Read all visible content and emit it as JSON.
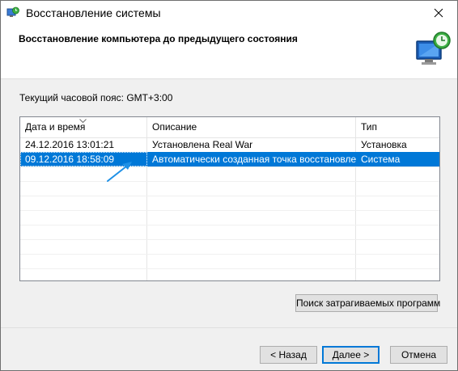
{
  "window": {
    "title": "Восстановление системы",
    "app_icon": "system-restore-icon",
    "close_icon": "close-icon"
  },
  "header": {
    "title": "Восстановление компьютера до предыдущего состояния",
    "icon": "system-restore-monitor-icon"
  },
  "timezone_label": "Текущий часовой пояс: GMT+3:00",
  "table": {
    "columns": [
      "Дата и время",
      "Описание",
      "Тип"
    ],
    "sorted_column": "Дата и время",
    "rows": [
      {
        "date": "24.12.2016 13:01:21",
        "description": "Установлена Real War",
        "type": "Установка",
        "selected": false
      },
      {
        "date": "09.12.2016 18:58:09",
        "description": "Автоматически созданная точка восстановле...",
        "type": "Система",
        "selected": true
      }
    ]
  },
  "buttons": {
    "search": "Поиск затрагиваемых программ",
    "back": "< Назад",
    "next": "Далее >",
    "cancel": "Отмена"
  },
  "colors": {
    "selection": "#0078d7",
    "annotation_arrow": "#1e90e6"
  }
}
